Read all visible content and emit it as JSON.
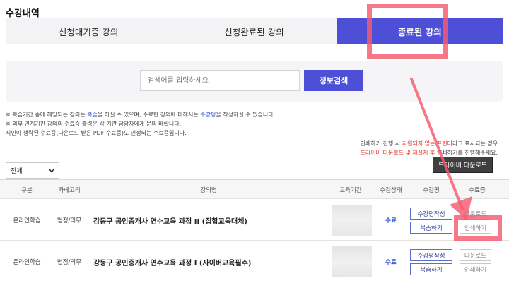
{
  "page": {
    "title": "수강내역"
  },
  "tabs": [
    {
      "label": "신청대기중 강의"
    },
    {
      "label": "신청완료된 강의"
    },
    {
      "label": "종료된 강의"
    }
  ],
  "search": {
    "placeholder": "검색어를 입력하세요",
    "button_label": "정보검색"
  },
  "notices": {
    "line1_pre": "※ 복습기간 중에 해당되는 강의는 ",
    "line1_review": "복습",
    "line1_mid": "을 하실 수 있으며, 수료한 강의에 대해서는 ",
    "line1_eval": "수강평",
    "line1_post": "을 작성하실 수 있습니다.",
    "line2": "※ 외부 연계기관 강의의 수료증 출력은 각 기관 담당자에게 문의 바랍니다.",
    "line3": "직인이 생략된 수료증(다운로드 받은 PDF 수료증)도 인정되는 수료증입니다."
  },
  "print_notice": {
    "line1_pre": "인쇄하기 진행 시 ",
    "line1_red": "지원되지 않는 프린터",
    "line1_post": "라고 표시되는 경우",
    "line2_red": "드라이버 다운로드 및 재설치 후",
    "line2_post": " 인쇄하기를 진행해주세요."
  },
  "filter": {
    "selected": "전체"
  },
  "driver_button": "드라이버 다운로드",
  "table": {
    "headers": [
      "구분",
      "카테고리",
      "강의명",
      "교육기간",
      "수강상태",
      "수강평",
      "수료증"
    ],
    "rows": [
      {
        "type": "온라인학습",
        "category": "법정/의무",
        "name": "강동구 공인중개사 연수교육 과정 II (집합교육대체)",
        "status": "수료",
        "review_btn": "수강평작성",
        "retake_btn": "복습하기",
        "download_btn": "다운로드",
        "print_btn": "인쇄하기"
      },
      {
        "type": "온라인학습",
        "category": "법정/의무",
        "name": "강동구 공인중개사 연수교육 과정 I (사이버교육필수)",
        "status": "수료",
        "review_btn": "수강평작성",
        "retake_btn": "복습하기",
        "download_btn": "다운로드",
        "print_btn": "인쇄하기"
      }
    ]
  },
  "colors": {
    "accent": "#4d4fd6",
    "highlight": "#f55a6e",
    "status_blue": "#3553d4",
    "notice_red": "#e0352b"
  }
}
